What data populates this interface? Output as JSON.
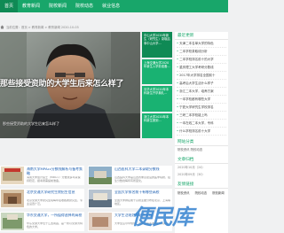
{
  "nav": {
    "items": [
      "首页",
      "教育新闻",
      "院校新闻",
      "院校动态",
      "就业信息"
    ],
    "active_index": 0
  },
  "breadcrumb": {
    "home_icon": "home-icon",
    "text": "当前位置：首页 > 教育新闻 > 教育新闻 2020-10-03"
  },
  "hero": {
    "headline": "那些接受资助的大学生后来怎么样了",
    "caption": "那些接受资助的大学生后来怎么样了"
  },
  "teasers": [
    "中山大学2020年新生（研究生）录取启事中山大学...",
    "上海交通大学2020年新生入学前准备...",
    "清华大学2020年本科新生开学典礼...",
    "浙江大学2020年本科新生报到..."
  ],
  "sidebar": {
    "latest_title": "最近更新",
    "latest": [
      "天津二本名单大学的特色",
      "二本学校录取线分析",
      "二本学校排名前十的大学",
      "重庆理工大学考研分数线",
      "2017年大学排名全国前十",
      "高考后大学生活什么样子",
      "浙江二本大学，培养方案",
      "一本学校都有哪些大学",
      "宁夏大学研究生学校排名",
      "三峡二本学校能上吗",
      "一本在线二本大学，专科",
      "什么学校排名前十大学"
    ],
    "stats_title": "网站分类",
    "stats_line": "院校资讯    院校动态",
    "archive_title": "文章归档",
    "archive_lines": [
      "2020年10月（24）",
      "2020年09月（30）"
    ],
    "links_title": "友情链接",
    "links": [
      "院校资讯",
      "院校动态",
      "院校新闻"
    ]
  },
  "cards": [
    {
      "title": "海南大学MPAcc分数线解析与备考策略",
      "excerpt": "海南大学会计硕士（MPAcc）分数线多年来保持稳定，报考者需提前准备。"
    },
    {
      "title": "山西医科大学二本录取分数线",
      "excerpt": "山西医科大学是山西省重点建设的医学院校，招生分数线每年有所变化。"
    },
    {
      "title": "北京交通大学研究生院招生信息",
      "excerpt": "北京交通大学研究生院每年招收各类研究生，专业设置广泛。"
    },
    {
      "title": "全国大学排名前十有哪些高校",
      "excerpt": "全国大学排名前十高校主要分布在北京、上海等地区。"
    },
    {
      "title": "华东交通大学，一所值得选择的高校",
      "excerpt": "华东交通大学位于江西南昌，是一所以交通为特色的大学。"
    },
    {
      "title": "大学生活规划与职业发展",
      "excerpt": "大学生应尽早规划，为未来职业发展打好基础。"
    }
  ],
  "watermark": "便民库",
  "colors": {
    "nav": "#18a66a",
    "nav_active": "#0f8a55",
    "teaser": "#19b272",
    "title_link": "#1a5db0",
    "watermark": "#3a86d1"
  }
}
